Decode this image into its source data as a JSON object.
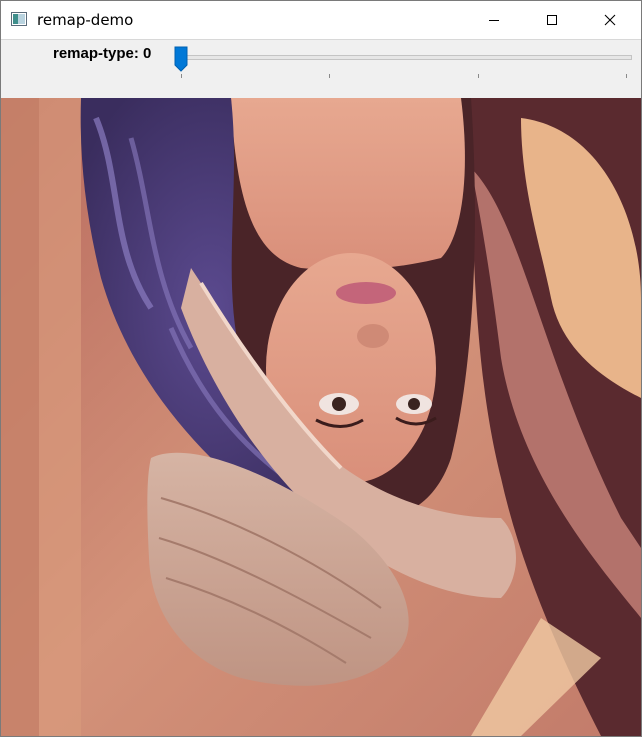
{
  "window": {
    "title": "remap-demo",
    "icon": "opencv-window-icon"
  },
  "controls": {
    "minimize_icon": "minimize-icon",
    "maximize_icon": "maximize-icon",
    "close_icon": "close-icon"
  },
  "trackbar": {
    "label": "remap-type: 0",
    "value": 0,
    "min": 0,
    "max": 3,
    "accent_color": "#0078d7"
  },
  "image": {
    "description_icon": "flipped-portrait-image"
  }
}
